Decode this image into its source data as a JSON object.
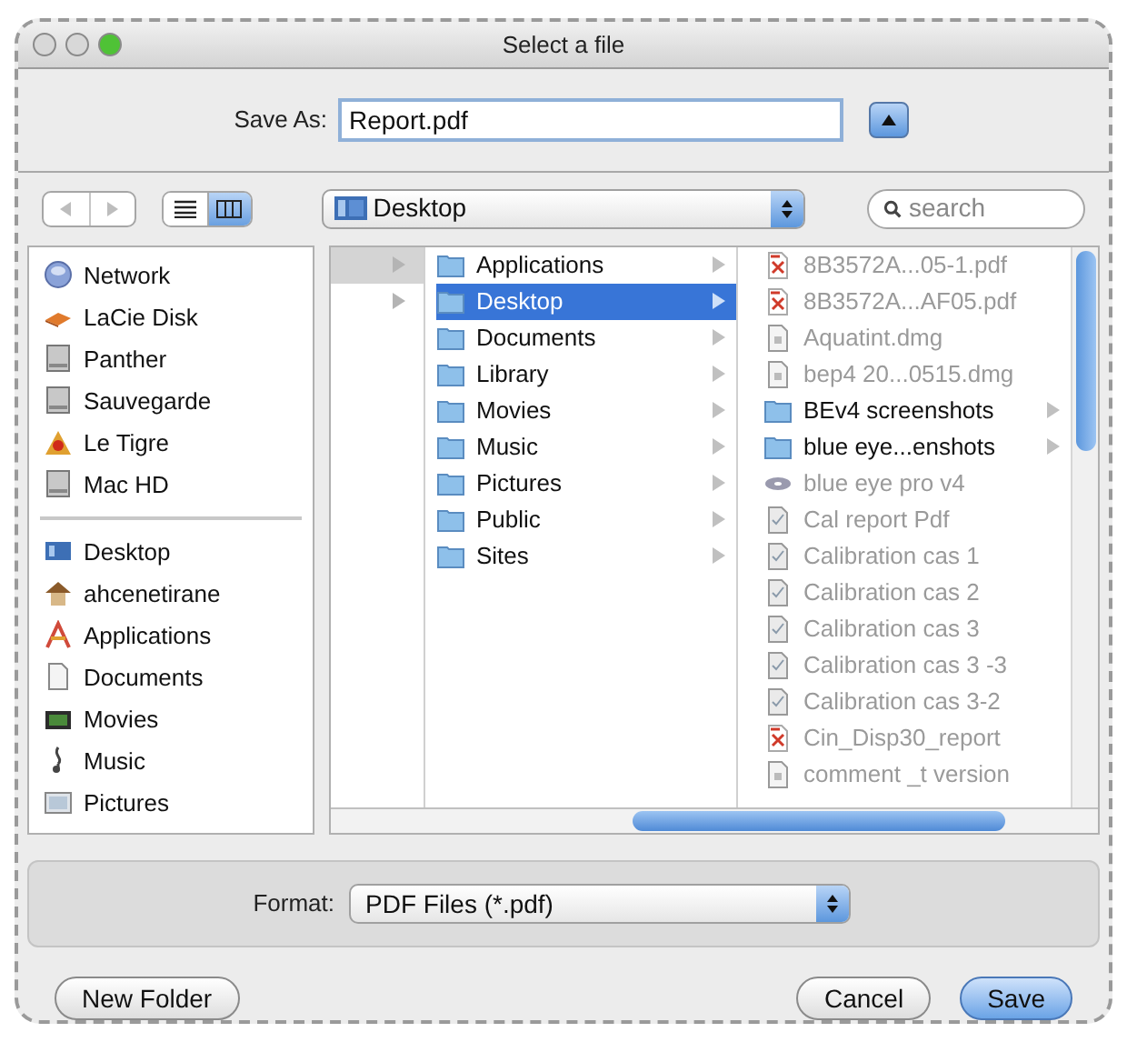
{
  "window": {
    "title": "Select a file"
  },
  "save_as": {
    "label": "Save As:",
    "value": "Report.pdf",
    "expanded": false
  },
  "toolbar": {
    "view_modes": [
      {
        "kind": "list",
        "selected": false
      },
      {
        "kind": "columns",
        "selected": true
      }
    ],
    "location": "Desktop",
    "search": {
      "placeholder": "search"
    }
  },
  "sidebar": {
    "groups": [
      {
        "items": [
          {
            "label": "Network",
            "kind": "network"
          },
          {
            "label": "LaCie Disk",
            "kind": "external"
          },
          {
            "label": "Panther",
            "kind": "drive"
          },
          {
            "label": "Sauvegarde",
            "kind": "drive"
          },
          {
            "label": "Le Tigre",
            "kind": "tiger"
          },
          {
            "label": "Mac HD",
            "kind": "drive"
          }
        ]
      },
      {
        "items": [
          {
            "label": "Desktop",
            "kind": "desktop"
          },
          {
            "label": "ahcenetirane",
            "kind": "home"
          },
          {
            "label": "Applications",
            "kind": "apps"
          },
          {
            "label": "Documents",
            "kind": "document"
          },
          {
            "label": "Movies",
            "kind": "movie"
          },
          {
            "label": "Music",
            "kind": "music"
          },
          {
            "label": "Pictures",
            "kind": "picture"
          }
        ]
      }
    ]
  },
  "columns": [
    {
      "rows": [
        {
          "selected": true
        },
        {
          "selected": false
        }
      ]
    },
    {
      "rows": [
        {
          "label": "Applications",
          "kind": "folder",
          "selected": false
        },
        {
          "label": "Desktop",
          "kind": "folder",
          "selected": true
        },
        {
          "label": "Documents",
          "kind": "folder",
          "selected": false
        },
        {
          "label": "Library",
          "kind": "folder",
          "selected": false
        },
        {
          "label": "Movies",
          "kind": "folder",
          "selected": false
        },
        {
          "label": "Music",
          "kind": "folder",
          "selected": false
        },
        {
          "label": "Pictures",
          "kind": "folder",
          "selected": false
        },
        {
          "label": "Public",
          "kind": "folder",
          "selected": false
        },
        {
          "label": "Sites",
          "kind": "folder",
          "selected": false
        }
      ]
    },
    {
      "rows": [
        {
          "label": "8B3572A...05-1.pdf",
          "kind": "pdf",
          "disabled": true
        },
        {
          "label": "8B3572A...AF05.pdf",
          "kind": "pdf",
          "disabled": true
        },
        {
          "label": "Aquatint.dmg",
          "kind": "file",
          "disabled": true
        },
        {
          "label": "bep4 20...0515.dmg",
          "kind": "file",
          "disabled": true
        },
        {
          "label": "BEv4 screenshots",
          "kind": "folder",
          "disabled": false
        },
        {
          "label": "blue eye...enshots",
          "kind": "folder",
          "disabled": false
        },
        {
          "label": "blue eye pro v4",
          "kind": "disk",
          "disabled": true
        },
        {
          "label": "Cal report Pdf",
          "kind": "doc",
          "disabled": true
        },
        {
          "label": "Calibration cas 1",
          "kind": "doc",
          "disabled": true
        },
        {
          "label": "Calibration cas 2",
          "kind": "doc",
          "disabled": true
        },
        {
          "label": "Calibration cas 3",
          "kind": "doc",
          "disabled": true
        },
        {
          "label": "Calibration cas 3 -3",
          "kind": "doc",
          "disabled": true
        },
        {
          "label": "Calibration cas 3-2",
          "kind": "doc",
          "disabled": true
        },
        {
          "label": "Cin_Disp30_report",
          "kind": "pdf",
          "disabled": true
        },
        {
          "label": "comment _t version",
          "kind": "file",
          "disabled": true
        }
      ]
    }
  ],
  "format": {
    "label": "Format:",
    "value": "PDF Files (*.pdf)"
  },
  "buttons": [
    {
      "label": "New Folder",
      "kind": "plain"
    },
    {
      "label": "Cancel",
      "kind": "plain"
    },
    {
      "label": "Save",
      "kind": "default"
    }
  ]
}
